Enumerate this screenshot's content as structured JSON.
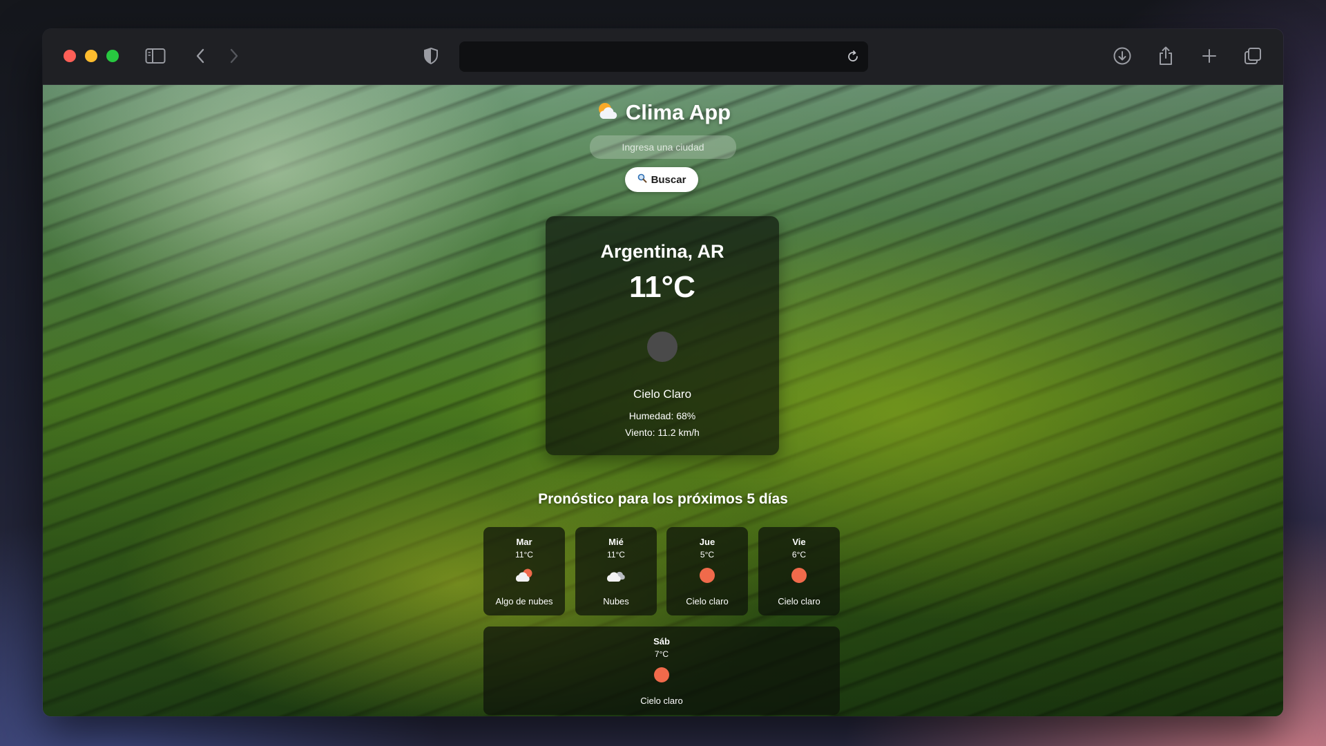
{
  "browser": {
    "url": "",
    "icons": [
      "sidebar-icon",
      "back-icon",
      "forward-icon",
      "shield-icon",
      "reload-icon",
      "download-icon",
      "share-icon",
      "new-tab-icon",
      "tabs-overview-icon"
    ]
  },
  "app": {
    "title": "Clima App",
    "search": {
      "placeholder": "Ingresa una ciudad",
      "value": ""
    },
    "search_button": "Buscar"
  },
  "current": {
    "city": "Argentina, AR",
    "temp": "11°C",
    "description": "Cielo Claro",
    "humidity": "Humedad: 68%",
    "wind": "Viento: 11.2 km/h"
  },
  "forecast": {
    "title": "Pronóstico para los próximos 5 días",
    "days": [
      {
        "day": "Mar",
        "temp": "11°C",
        "icon": "partly-cloudy-icon",
        "desc": "Algo de nubes"
      },
      {
        "day": "Mié",
        "temp": "11°C",
        "icon": "cloud-icon",
        "desc": "Nubes"
      },
      {
        "day": "Jue",
        "temp": "5°C",
        "icon": "sun-icon",
        "desc": "Cielo claro"
      },
      {
        "day": "Vie",
        "temp": "6°C",
        "icon": "sun-icon",
        "desc": "Cielo claro"
      },
      {
        "day": "Sáb",
        "temp": "7°C",
        "icon": "sun-icon",
        "desc": "Cielo claro"
      }
    ]
  },
  "colors": {
    "sun": "#f06a4b",
    "card_bg": "rgba(12,18,10,0.7)"
  }
}
